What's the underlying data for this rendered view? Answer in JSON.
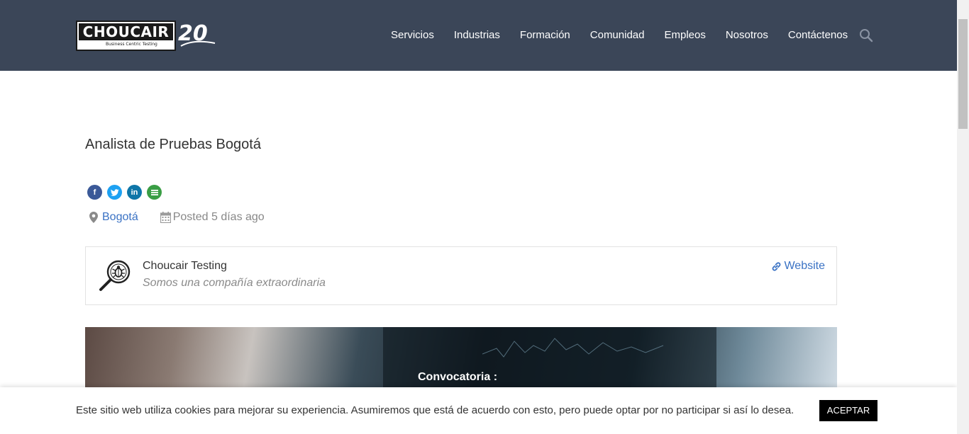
{
  "brand": {
    "logo_text": "CHOUCAIR",
    "logo_tagline": "Business Centric Testing",
    "anniversary": "20",
    "header_bg": "#3b4658"
  },
  "nav": {
    "items": [
      "Servicios",
      "Industrias",
      "Formación",
      "Comunidad",
      "Empleos",
      "Nosotros",
      "Contáctenos"
    ],
    "search_icon": "search-icon"
  },
  "job": {
    "title": "Analista de Pruebas Bogotá",
    "location": "Bogotá",
    "posted": "Posted 5 días ago",
    "share_icons": [
      "facebook-icon",
      "twitter-icon",
      "linkedin-icon",
      "more-share-icon"
    ]
  },
  "company": {
    "name": "Choucair Testing",
    "tagline": "Somos una compañía extraordinaria",
    "website_label": "Website"
  },
  "banner": {
    "text": "Convocatoria :"
  },
  "cookie": {
    "message": "Este sitio web utiliza cookies para mejorar su experiencia. Asumiremos que está de acuerdo con esto, pero puede optar por no participar si así lo desea.",
    "accept_label": "ACEPTAR"
  },
  "colors": {
    "link": "#3a72c4",
    "share_facebook": "#3b5998",
    "share_twitter": "#1da1f2",
    "share_linkedin": "#0e76a8",
    "share_more": "#3a9e45"
  }
}
